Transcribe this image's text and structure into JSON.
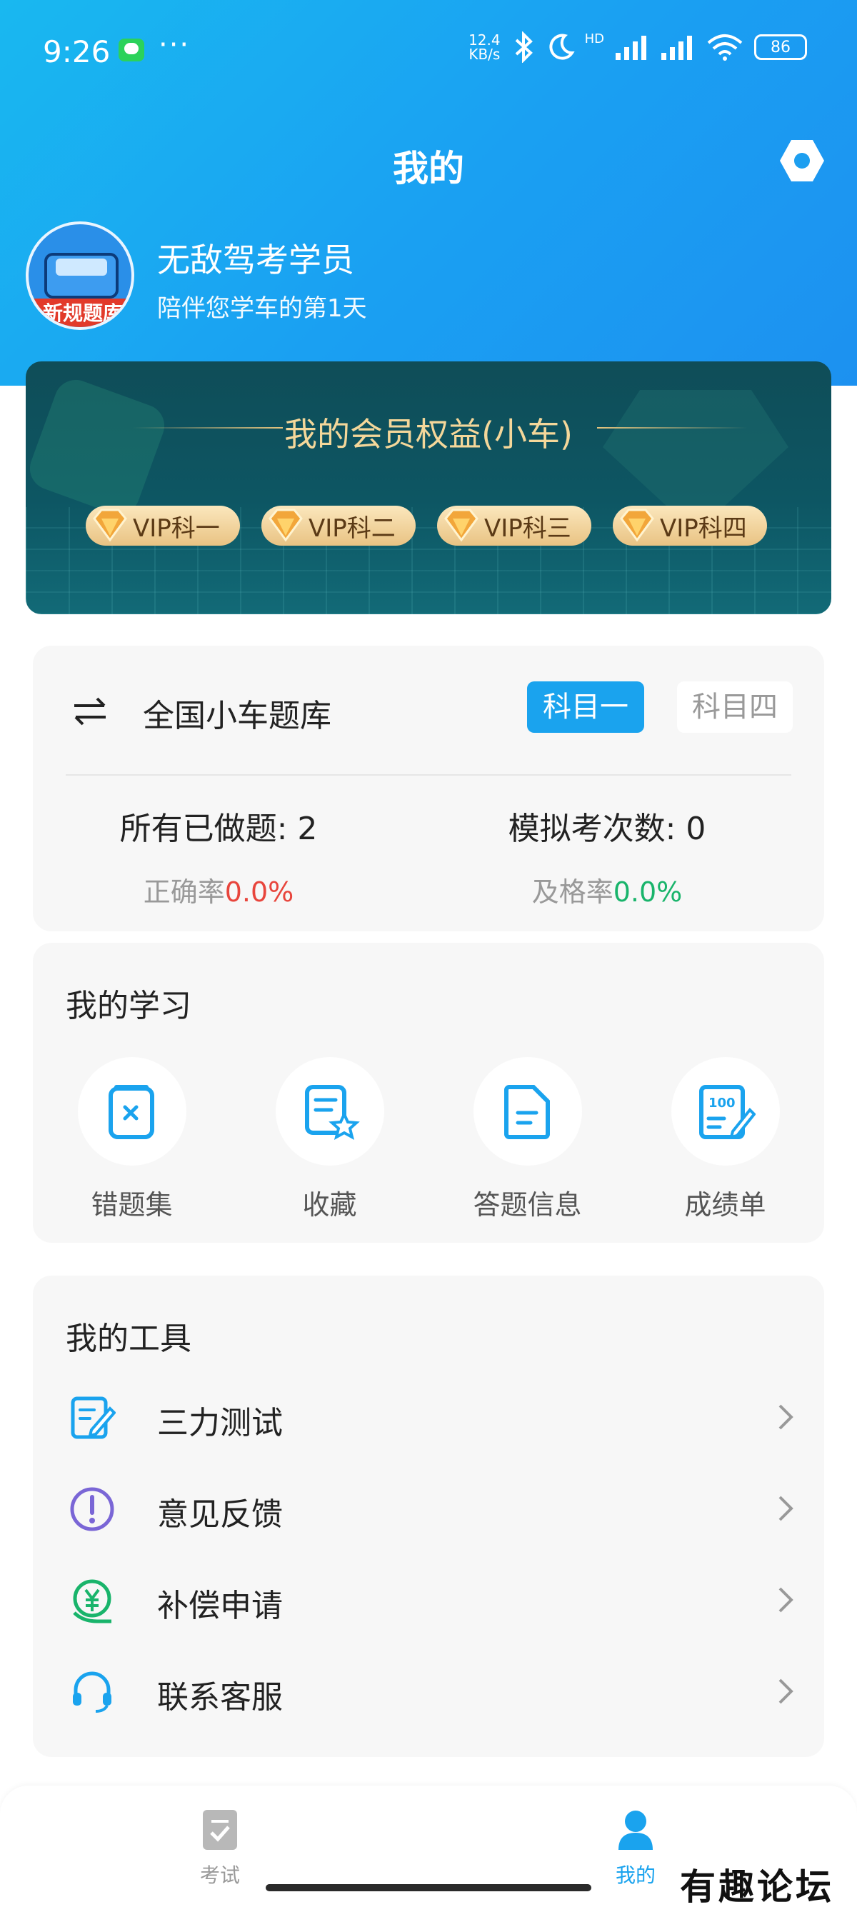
{
  "status_bar": {
    "time": "9:26",
    "dots": "···",
    "speed_value": "12.4",
    "speed_unit": "KB/s",
    "network": "HD",
    "battery": "86"
  },
  "header": {
    "title": "我的"
  },
  "user": {
    "name": "无敌驾考学员",
    "subtitle": "陪伴您学车的第1天",
    "avatar_text": "新规题库"
  },
  "vip": {
    "title": "我的会员权益(小车)",
    "badges": [
      "VIP科一",
      "VIP科二",
      "VIP科三",
      "VIP科四"
    ]
  },
  "question_bank": {
    "title": "全国小车题库",
    "segments": [
      "科目一",
      "科目四"
    ],
    "active_segment": "科目一",
    "done_label": "所有已做题: 2",
    "accuracy_label": "正确率",
    "accuracy_value": "0.0%",
    "mock_label": "模拟考次数: 0",
    "pass_label": "及格率",
    "pass_value": "0.0%"
  },
  "study": {
    "title": "我的学习",
    "items": [
      {
        "label": "错题集",
        "icon": "wrong-book-icon"
      },
      {
        "label": "收藏",
        "icon": "favorite-icon"
      },
      {
        "label": "答题信息",
        "icon": "document-icon"
      },
      {
        "label": "成绩单",
        "icon": "score-sheet-icon"
      }
    ]
  },
  "tools": {
    "title": "我的工具",
    "items": [
      {
        "label": "三力测试",
        "icon": "edit-note-icon"
      },
      {
        "label": "意见反馈",
        "icon": "exclamation-icon"
      },
      {
        "label": "补偿申请",
        "icon": "yuan-refund-icon"
      },
      {
        "label": "联系客服",
        "icon": "headset-icon"
      }
    ]
  },
  "tabbar": {
    "items": [
      {
        "label": "考试",
        "icon": "exam-icon",
        "active": false
      },
      {
        "label": "我的",
        "icon": "person-icon",
        "active": true
      }
    ]
  },
  "watermark": "有趣论坛",
  "colors": {
    "primary": "#1aa3ee",
    "vip_gold": "#f4d79a",
    "accuracy_red": "#e8453c",
    "pass_green": "#19b46b"
  }
}
